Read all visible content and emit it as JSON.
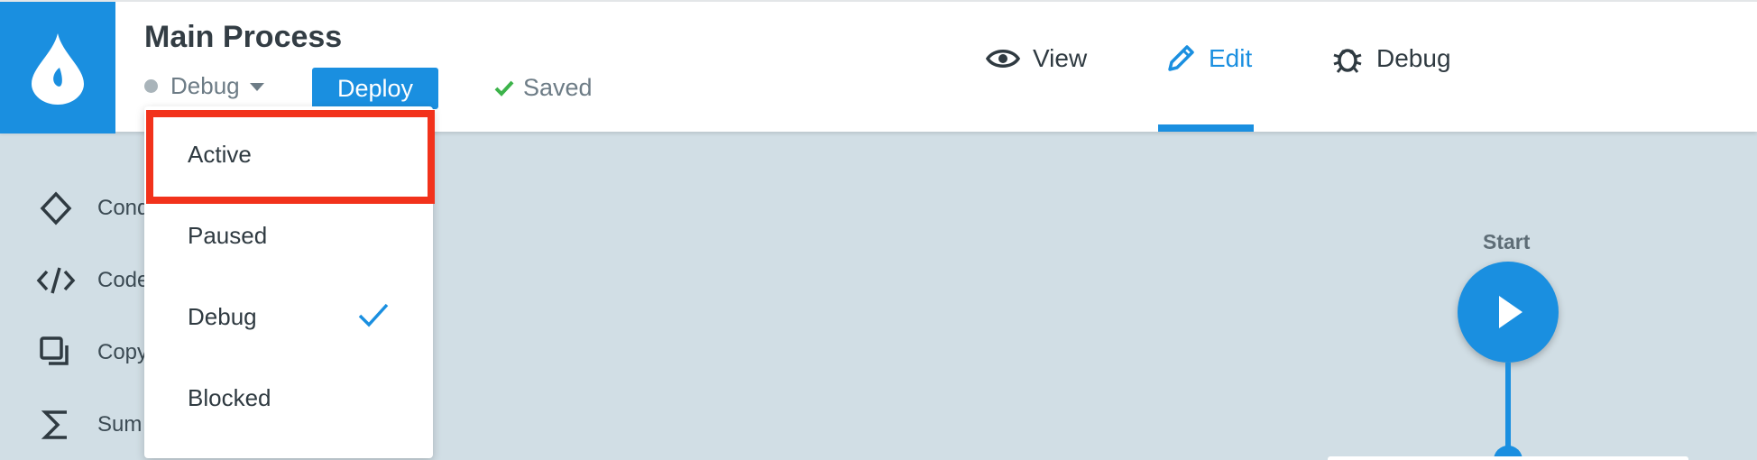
{
  "header": {
    "title": "Main Process",
    "status_value": "Debug",
    "deploy_label": "Deploy",
    "saved_label": "Saved"
  },
  "mode_tabs": [
    {
      "label": "View",
      "icon": "eye-icon",
      "active": false
    },
    {
      "label": "Edit",
      "icon": "pencil-icon",
      "active": true
    },
    {
      "label": "Debug",
      "icon": "bug-icon",
      "active": false
    }
  ],
  "sidebar": {
    "items": [
      {
        "label": "Cond",
        "icon": "diamond-icon"
      },
      {
        "label": "Code",
        "icon": "code-icon"
      },
      {
        "label": "Copy",
        "icon": "copy-icon"
      },
      {
        "label": "Sum",
        "icon": "sigma-icon"
      }
    ]
  },
  "status_menu": {
    "items": [
      {
        "label": "Active",
        "highlighted": true
      },
      {
        "label": "Paused"
      },
      {
        "label": "Debug",
        "checked": true
      },
      {
        "label": "Blocked"
      }
    ]
  },
  "canvas": {
    "start_label": "Start"
  },
  "colors": {
    "accent": "#1a8fe0",
    "canvas_bg": "#d1dee5",
    "highlight": "#f2321b",
    "saved_check": "#3cb34a"
  }
}
